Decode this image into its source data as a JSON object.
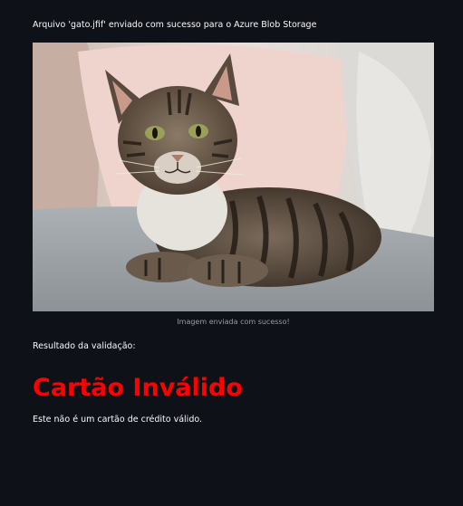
{
  "upload": {
    "message": "Arquivo 'gato.jfif' enviado com sucesso para o Azure Blob Storage"
  },
  "image": {
    "subject": "tabby cat lying on a sofa",
    "caption": "Imagem enviada com sucesso!"
  },
  "result": {
    "label": "Resultado da validação:",
    "title": "Cartão Inválido",
    "message": "Este não é um cartão de crédito válido.",
    "title_color": "#ff0000"
  },
  "theme": {
    "background": "#0e1117",
    "text": "#fafafa",
    "caption": "#9a9ca3"
  }
}
